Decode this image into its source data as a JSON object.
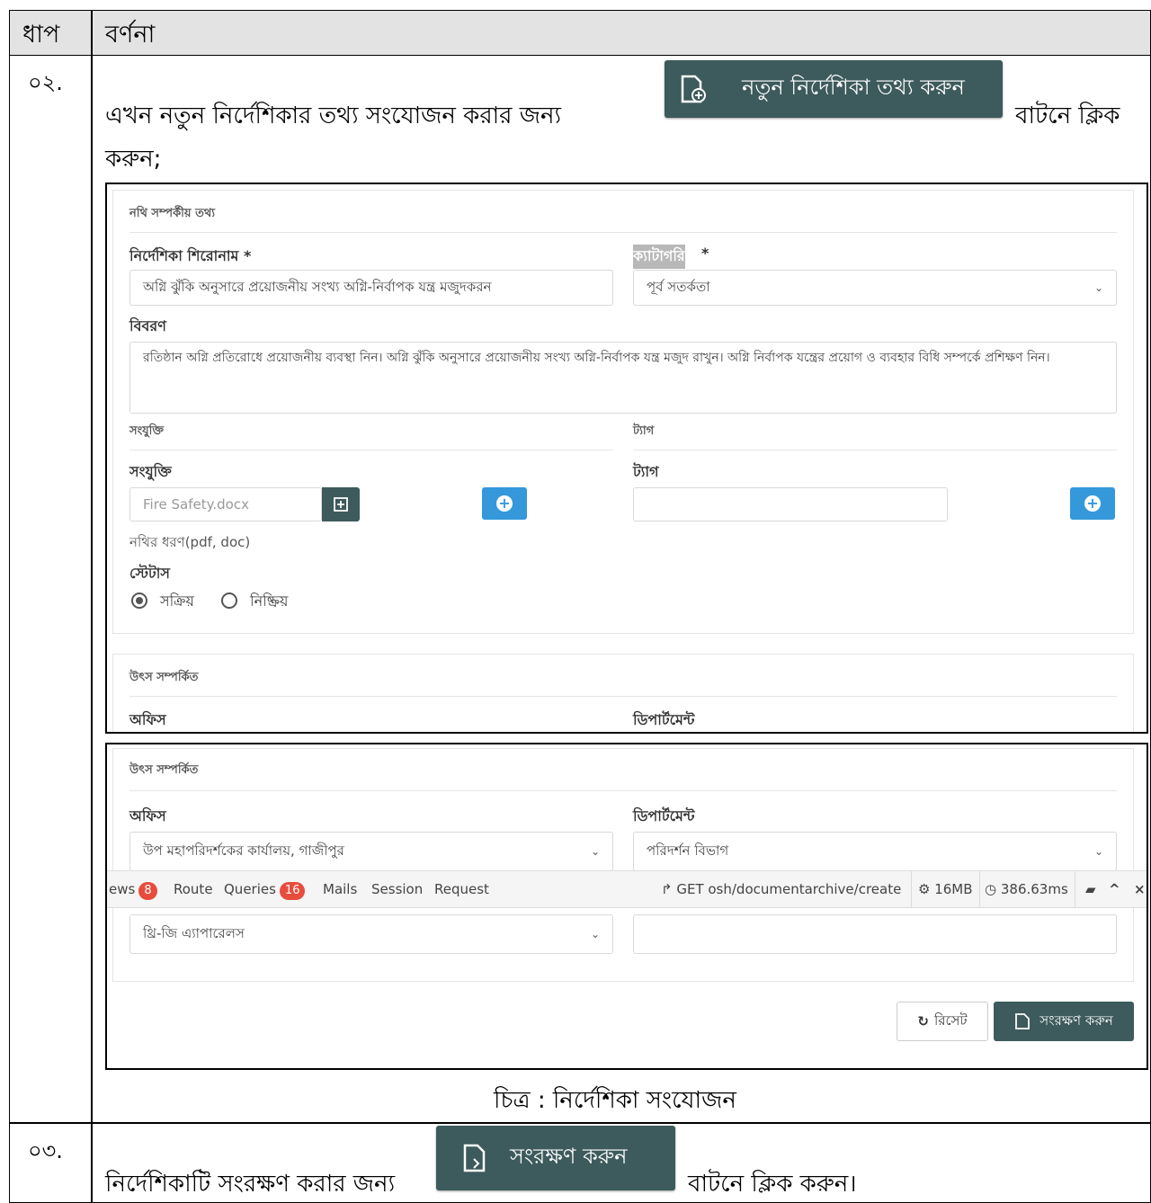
{
  "table": {
    "header_step": "ধাপ",
    "header_desc": "বর্ণনা"
  },
  "rows": [
    {
      "step": "০২.",
      "text_before": "এখন নতুন নির্দেশিকার তথ্য সংযোজন করার জন্য",
      "button_label": "নতুন নির্দেশিকা তথ্য করুন",
      "text_after": "বাটনে ক্লিক",
      "text_cont": "করুন;"
    },
    {
      "step": "০৩.",
      "text_before": "নির্দেশিকাটি সংরক্ষণ করার জন্য",
      "button_label": "সংরক্ষণ করুন",
      "text_after": "বাটনে ক্লিক করুন।"
    }
  ],
  "form": {
    "section_title": "নথি সম্পর্কীয় তথ্য",
    "title_label": "নির্দেশিকা শিরোনাম *",
    "title_value": "অগ্নি ঝুঁকি অনুসারে প্রয়োজনীয় সংখ্য অগ্নি-নির্বাপক যন্ত্র মজুদকরন",
    "category_label": "ক্যাটাগরি",
    "category_star": "*",
    "category_value": "পূর্ব সতর্কতা",
    "desc_label": "বিবরণ",
    "desc_value": "রতিষ্ঠান অগ্নি প্রতিরোধে প্রয়োজনীয় ব্যবস্থা নিন। অগ্নি ঝুঁকি অনুসারে প্রয়োজনীয় সংখ্য অগ্নি-নির্বাপক যন্ত্র মজুদ রাখুন। অগ্নি নির্বাপক যন্ত্রের প্রয়োগ ও ব্যবহার বিধি সম্পর্কে প্রশিক্ষণ নিন।",
    "attach_section": "সংযুক্তি",
    "tag_section": "ট্যাগ",
    "attach_label": "সংযুক্তি",
    "attach_placeholder": "Fire Safety.docx",
    "file_type_note": "নথির ধরণ(pdf, doc)",
    "tag_label": "ট্যাগ",
    "status_label": "স্টেটাস",
    "status_active": "সক্রিয়",
    "status_inactive": "নিষ্ক্রিয়",
    "source_section": "উৎস সম্পর্কিত",
    "office_label": "অফিস",
    "department_label": "ডিপার্টমেন্ট"
  },
  "form2": {
    "source_section": "উৎস সম্পর্কিত",
    "office_label": "অফিস",
    "department_label": "ডিপার্টমেন্ট",
    "office_value": "উপ মহাপরিদর্শকের কার্যালয়, গাজীপুর",
    "department_value": "পরিদর্শন বিভাগ",
    "factory_value": "থ্রি-জি এ্যাপারেলস",
    "reset_label": "রিসেট",
    "save_label": "সংরক্ষণ করুন"
  },
  "debugbar": {
    "views": "ews",
    "views_count": "8",
    "route": "Route",
    "queries": "Queries",
    "queries_count": "16",
    "mails": "Mails",
    "session": "Session",
    "request": "Request",
    "request_info": "GET osh/documentarchive/create",
    "memory": "16MB",
    "time": "386.63ms"
  },
  "caption": "চিত্র : নির্দেশিকা সংযোজন"
}
